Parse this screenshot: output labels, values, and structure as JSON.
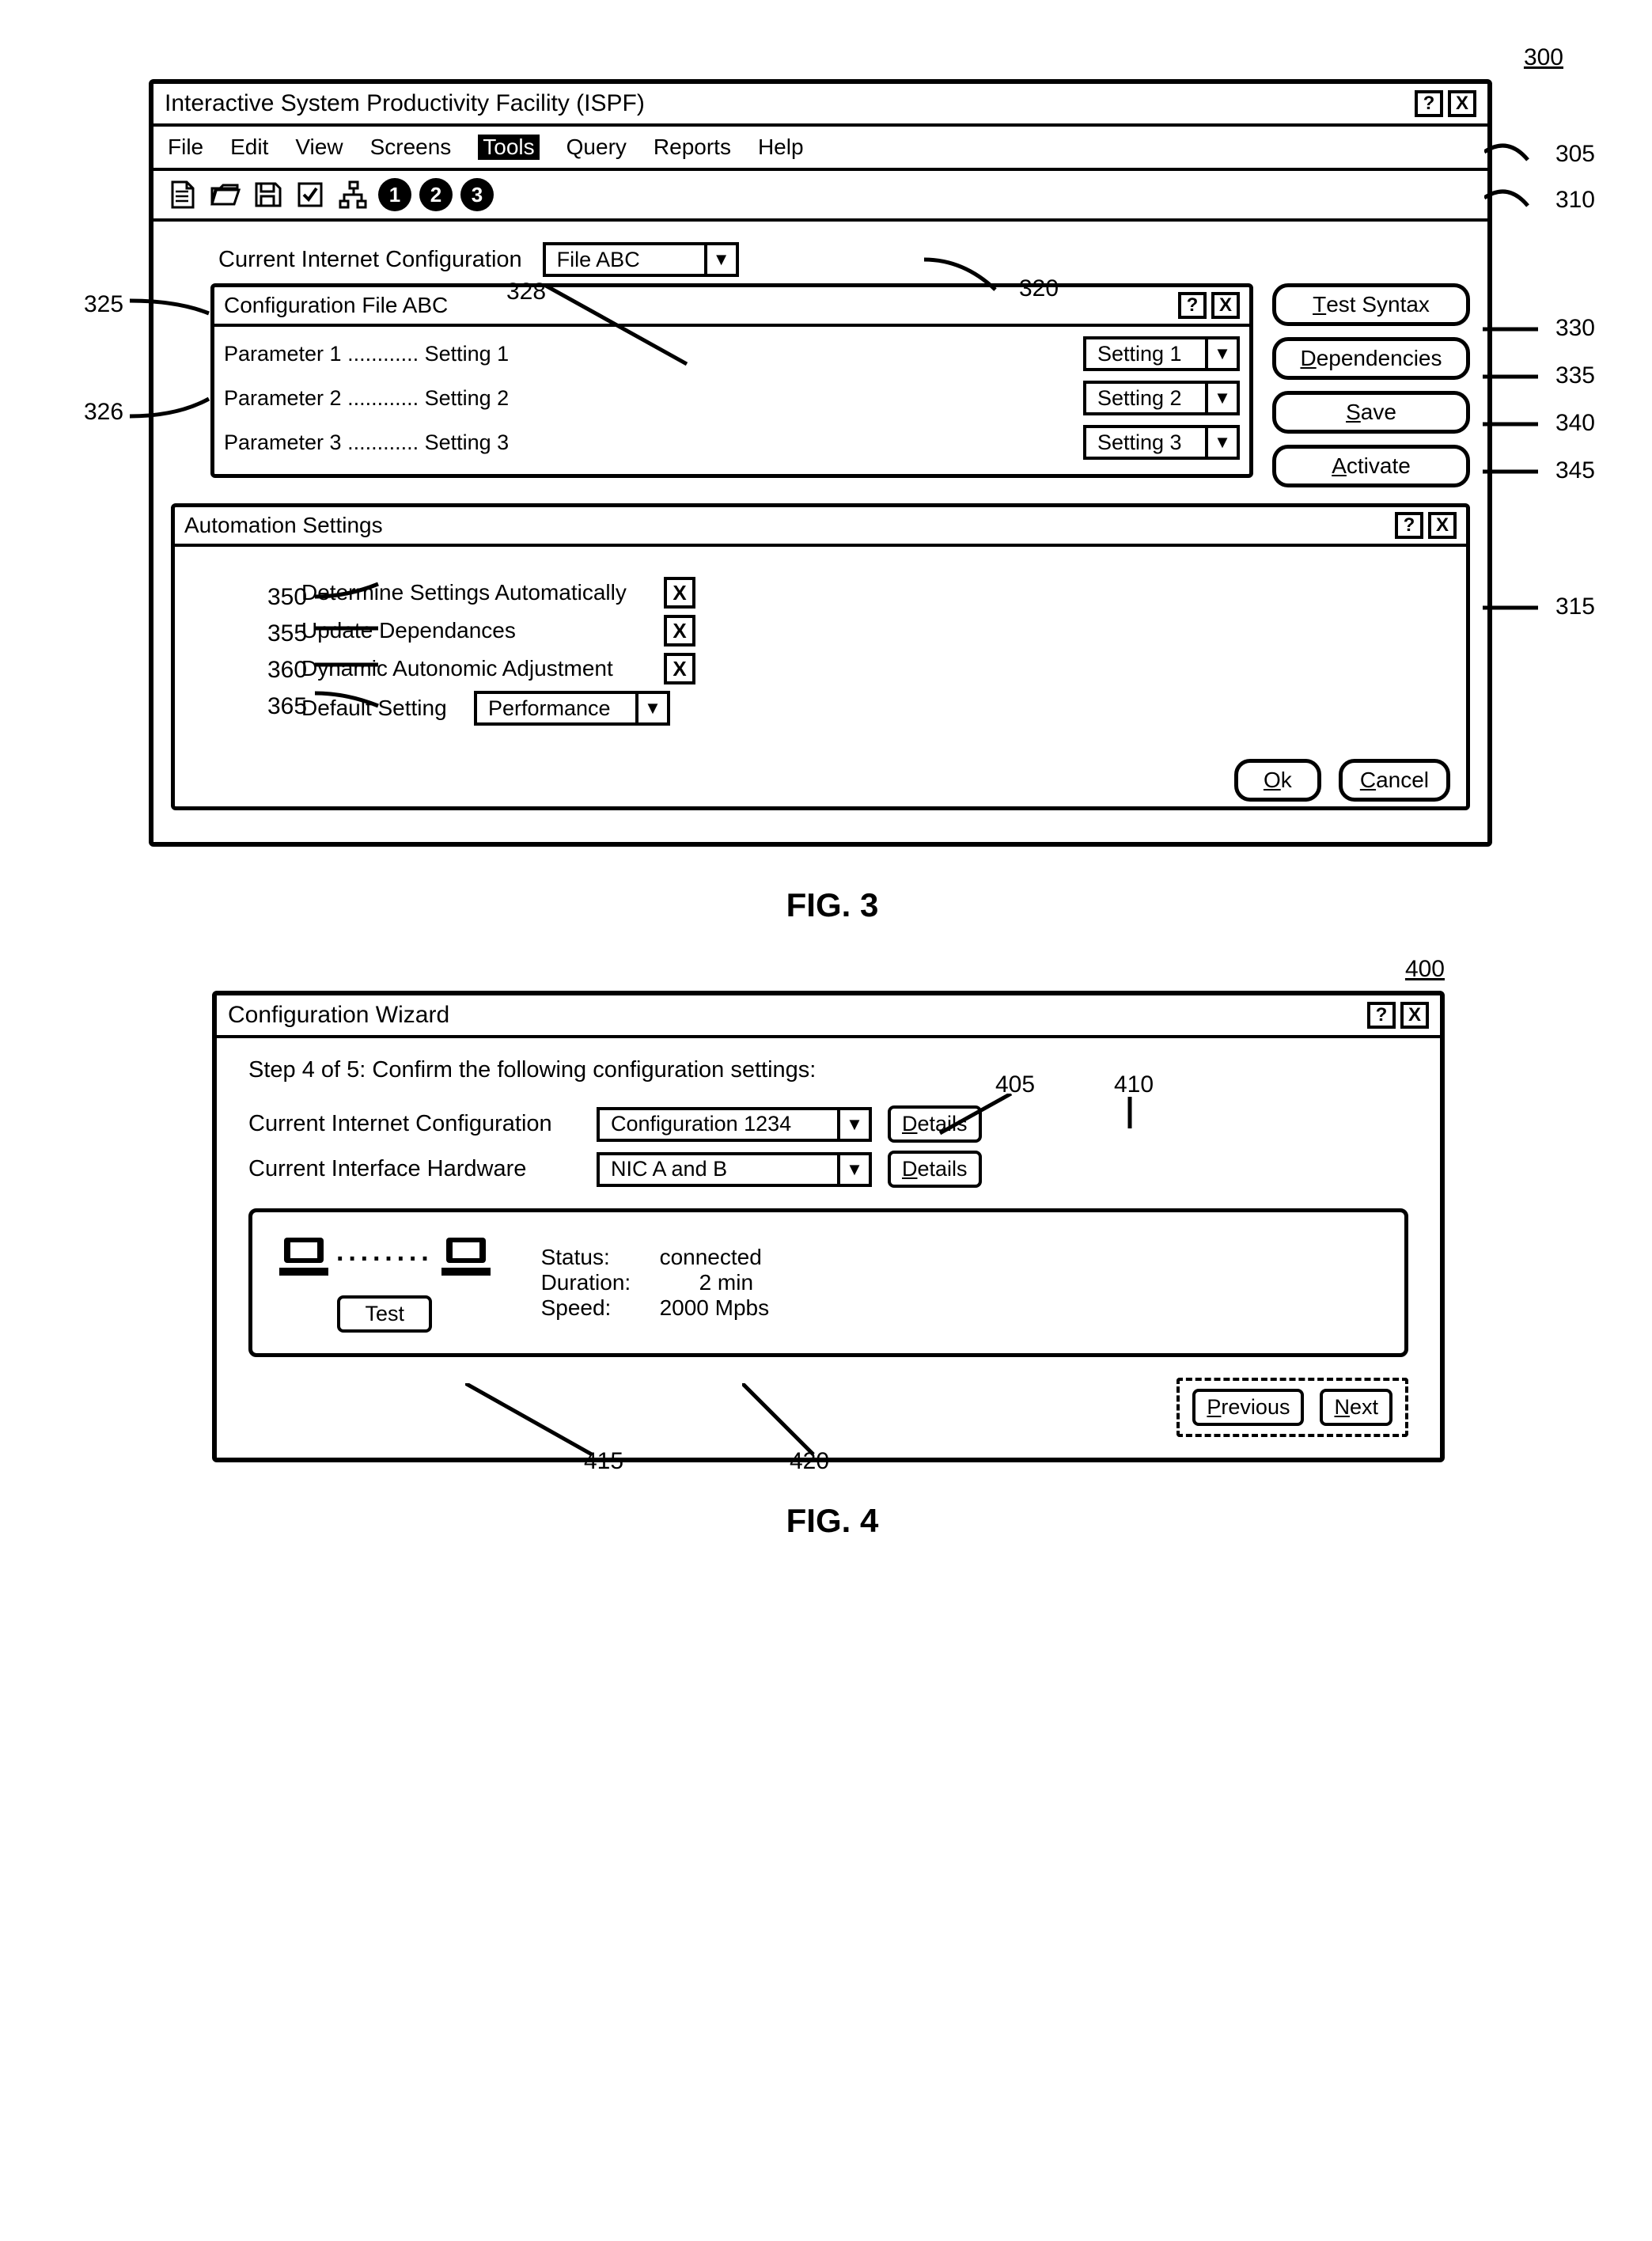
{
  "figure3": {
    "ref_number": "300",
    "caption": "FIG. 3",
    "window": {
      "title": "Interactive System Productivity Facility (ISPF)",
      "help_glyph": "?",
      "close_glyph": "X",
      "menu": [
        "File",
        "Edit",
        "View",
        "Screens",
        "Tools",
        "Query",
        "Reports",
        "Help"
      ],
      "menu_active_index": 4,
      "toolbar_circles": [
        "1",
        "2",
        "3"
      ],
      "current_config_label": "Current Internet Configuration",
      "current_config_value": "File ABC",
      "config_panel": {
        "title": "Configuration File ABC",
        "params": [
          {
            "text": "Parameter 1 ............ Setting  1",
            "dropdown": "Setting 1"
          },
          {
            "text": "Parameter 2 ............ Setting  2",
            "dropdown": "Setting 2"
          },
          {
            "text": "Parameter 3 ............ Setting  3",
            "dropdown": "Setting 3"
          }
        ]
      },
      "action_buttons": {
        "test_syntax": "est Syntax",
        "dependencies": "ependencies",
        "save": "ave",
        "activate": "ctivate"
      },
      "automation": {
        "title": "Automation Settings",
        "rows": [
          {
            "label": "Determine Settings Automatically",
            "checked": true
          },
          {
            "label": "Update Dependances",
            "checked": true
          },
          {
            "label": "Dynamic Autonomic Adjustment",
            "checked": true
          }
        ],
        "default_label": "Default Setting",
        "default_value": "Performance",
        "ok": "k",
        "cancel": "ancel"
      }
    },
    "annotations": {
      "a305": "305",
      "a310": "310",
      "a315": "315",
      "a320": "320",
      "a325": "325",
      "a326": "326",
      "a328": "328",
      "a330": "330",
      "a335": "335",
      "a340": "340",
      "a345": "345",
      "a350": "350",
      "a355": "355",
      "a360": "360",
      "a365": "365"
    }
  },
  "figure4": {
    "ref_number": "400",
    "caption": "FIG. 4",
    "window": {
      "title": "Configuration Wizard",
      "step_text": "Step 4 of 5: Confirm the following configuration settings:",
      "rows": [
        {
          "label": "Current Internet Configuration",
          "value": "Configuration 1234",
          "btn": "etails"
        },
        {
          "label": "Current Interface Hardware",
          "value": "NIC A and B",
          "btn": "etails"
        }
      ],
      "test_btn": "Test",
      "stats": {
        "status_lbl": "Status:",
        "status_val": "connected",
        "dur_lbl": "Duration:",
        "dur_val": "2 min",
        "spd_lbl": "Speed:",
        "spd_val": "2000 Mpbs"
      },
      "prev": "revious",
      "next": "ext"
    },
    "annotations": {
      "a405": "405",
      "a410": "410",
      "a415": "415",
      "a420": "420"
    }
  }
}
